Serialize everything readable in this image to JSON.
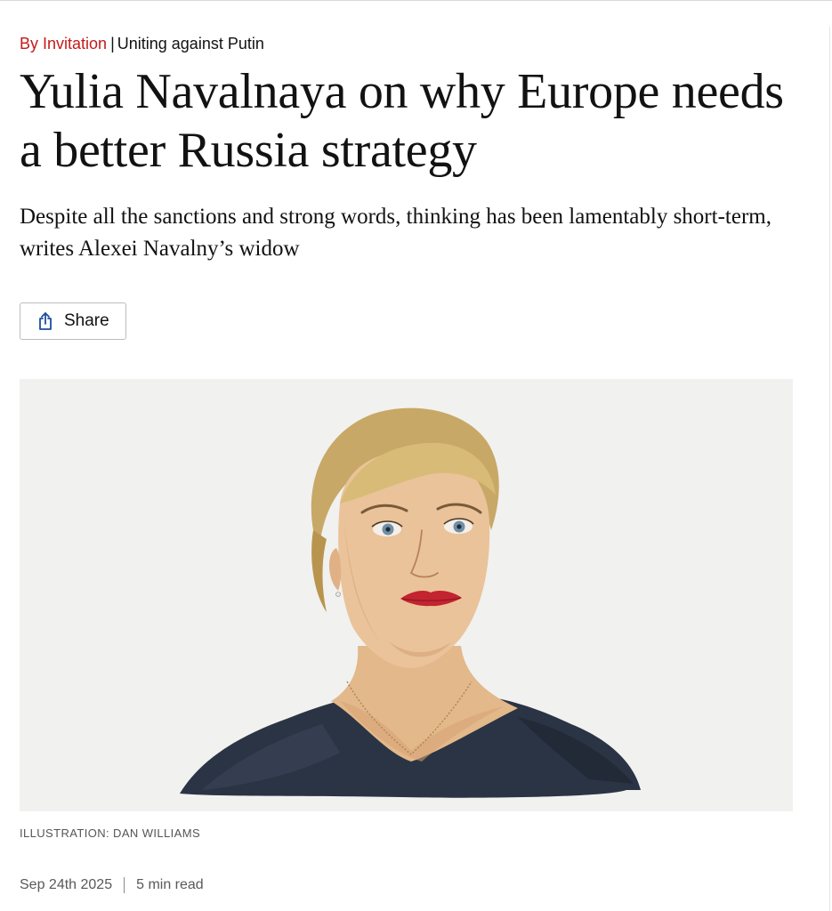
{
  "article": {
    "flytitle": "By Invitation",
    "series": "Uniting against Putin",
    "headline": "Yulia Navalnaya on why Europe needs a better Russia strategy",
    "standfirst": "Despite all the sanctions and strong words, thinking has been lamentably short-term, writes Alexei Navalny’s widow",
    "share_label": "Share",
    "share_icon": "share-icon",
    "image_credit": "ILLUSTRATION: DAN WILLIAMS",
    "date": "Sep 24th 2025",
    "read_time": "5 min read"
  },
  "colors": {
    "flytitle": "#c41a1a",
    "share_icon": "#1e4d9b",
    "text": "#121212",
    "meta": "#595959",
    "illustration_bg": "#f1f1ef"
  }
}
